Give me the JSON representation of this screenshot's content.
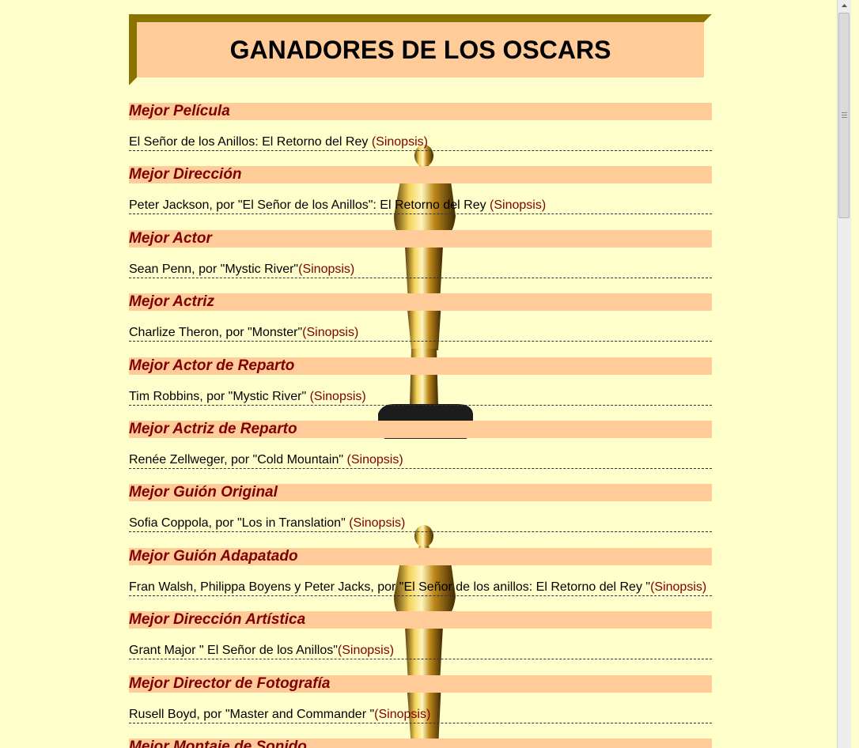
{
  "title": "GANADORES DE LOS OSCARS",
  "link_label": "(Sinopsis)",
  "colors": {
    "background": "#FFFFCC",
    "category_bar": "#FFCC99",
    "category_text": "#800000",
    "banner_bg": "#FFCC99",
    "banner_shadow": "#8B7300"
  },
  "categories": [
    {
      "heading": "Mejor Película",
      "winner": "El Señor de los Anillos: El Retorno del Rey ",
      "link": "(Sinopsis)"
    },
    {
      "heading": "Mejor Dirección",
      "winner": "Peter Jackson, por \"El Señor de los Anillos\": El Retorno del Rey ",
      "link": "(Sinopsis)"
    },
    {
      "heading": "Mejor Actor",
      "winner": "Sean Penn, por \"Mystic River\"",
      "link": "(Sinopsis)"
    },
    {
      "heading": "Mejor Actriz",
      "winner": "Charlize Theron, por \"Monster\"",
      "link": "(Sinopsis)"
    },
    {
      "heading": "Mejor Actor de Reparto",
      "winner": "Tim Robbins, por \"Mystic River\" ",
      "link": "(Sinopsis)"
    },
    {
      "heading": "Mejor Actriz de Reparto",
      "winner": "Renée Zellweger, por \"Cold Mountain\" ",
      "link": "(Sinopsis)"
    },
    {
      "heading": "Mejor Guión Original",
      "winner": "Sofia Coppola, por \"Los in Translation\" ",
      "link": "(Sinopsis)"
    },
    {
      "heading": "Mejor Guión Adapatado",
      "winner": "Fran Walsh, Philippa Boyens y Peter Jacks, por \"El Señor de los anillos: El Retorno del Rey \"",
      "link": "(Sinopsis)"
    },
    {
      "heading": "Mejor Dirección Artística",
      "winner": "Grant Major \" El Señor de los Anillos\"",
      "link": "(Sinopsis)"
    },
    {
      "heading": "Mejor Director de Fotografía",
      "winner": "Rusell Boyd, por \"Master and Commander \"",
      "link": "(Sinopsis)"
    },
    {
      "heading": "Mejor Montaje de Sonido",
      "winner": "",
      "link": ""
    }
  ],
  "icons": {
    "background_image": "oscar-statuette-icon",
    "scroll_up": "scroll-up-arrow-icon"
  }
}
